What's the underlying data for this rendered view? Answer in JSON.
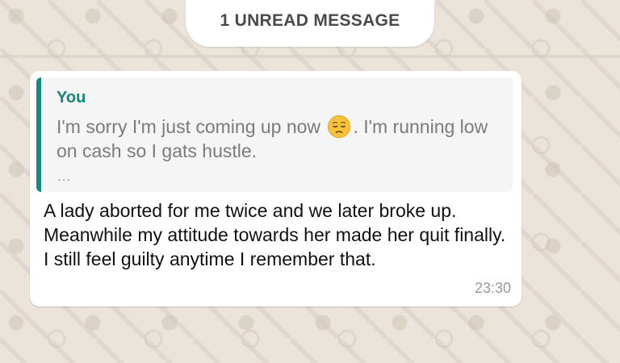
{
  "unread_banner": {
    "label": "1 UNREAD MESSAGE"
  },
  "message": {
    "quoted": {
      "author": "You",
      "text_before_emoji": "I'm sorry I'm just coming up now ",
      "emoji_icon": "pensive-face-emoji",
      "text_after_emoji": ". I'm running low on cash so I gats hustle.",
      "more_indicator": "..."
    },
    "body": "A lady aborted for me twice and we later broke up. Meanwhile my attitude towards her made her quit finally. I still feel guilty anytime I remember that.",
    "time": "23:30"
  },
  "colors": {
    "quote_accent": "#128c7e",
    "quote_author": "#16877a",
    "wallpaper": "#ece5dd",
    "bubble": "#ffffff"
  }
}
